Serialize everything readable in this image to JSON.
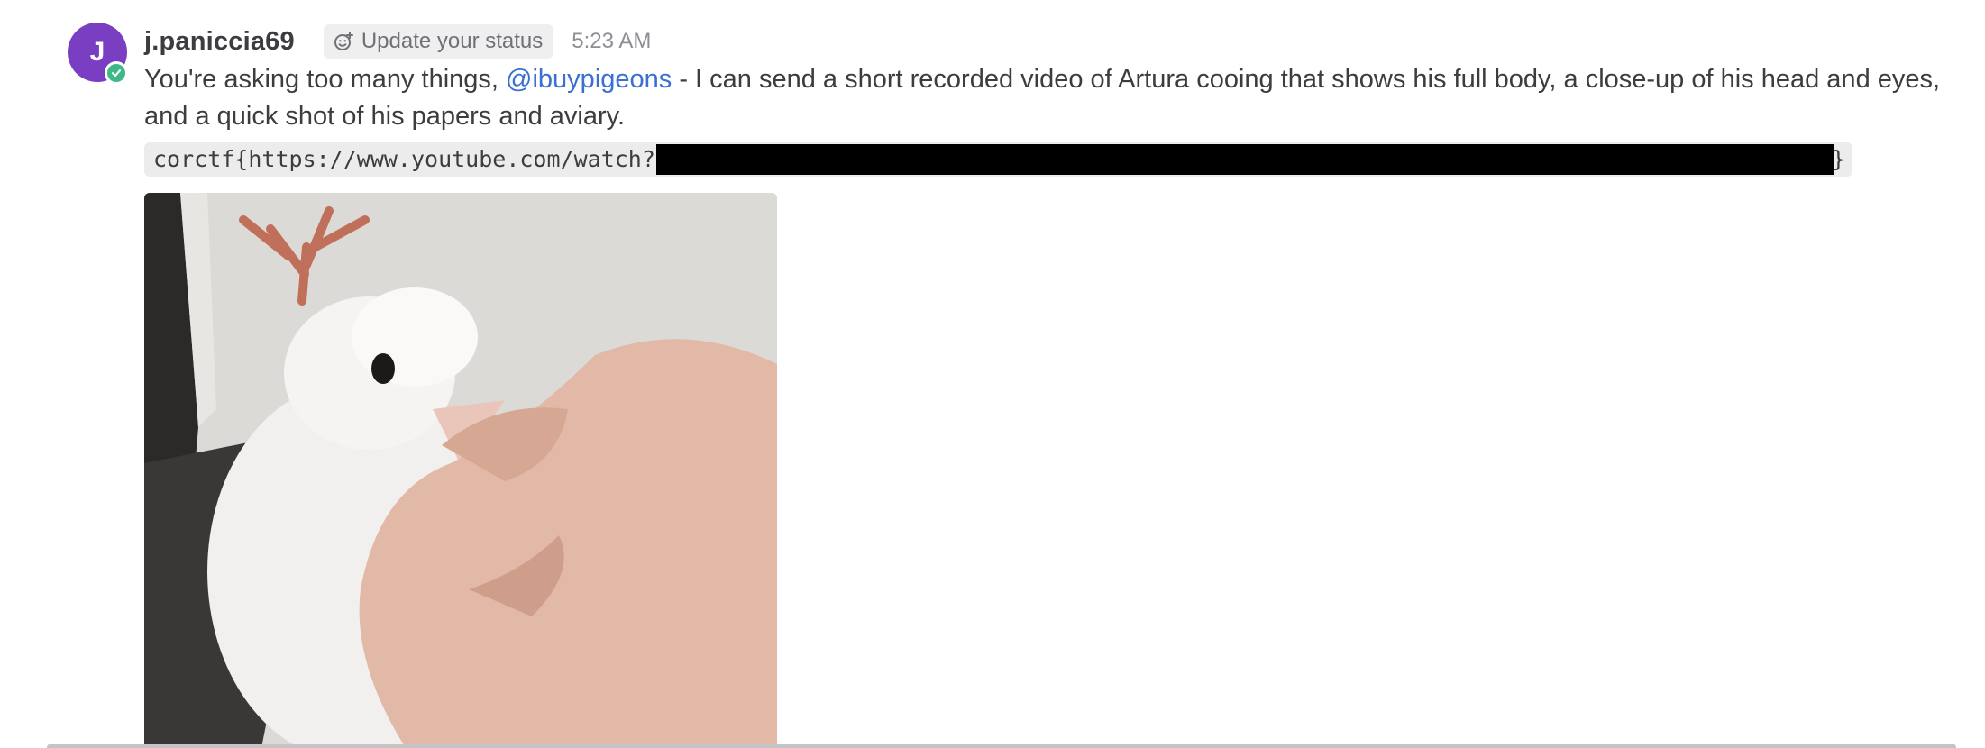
{
  "post": {
    "avatar_initial": "J",
    "username": "j.paniccia69",
    "status_button_label": "Update your status",
    "timestamp": "5:23 AM",
    "message_prefix": "You're asking too many things, ",
    "mention": "@ibuypigeons",
    "message_suffix": " -  I can send a short recorded video of Artura cooing that shows his full body, a close-up of his head and eyes, and a quick shot of his papers and aviary.",
    "code_prefix": "corctf{https://www.youtube.com/watch?",
    "code_suffix": "}",
    "image_name": "pigeon-gif"
  },
  "colors": {
    "avatar": "#7a3ec2",
    "online": "#3db887",
    "mention": "#3a6fd3",
    "code_bg": "#ececec"
  }
}
